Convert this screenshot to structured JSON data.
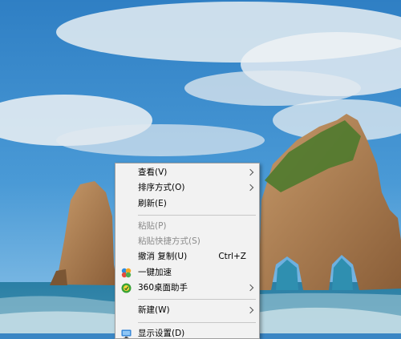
{
  "context_menu": {
    "view": {
      "label": "查看(V)"
    },
    "sort": {
      "label": "排序方式(O)"
    },
    "refresh": {
      "label": "刷新(E)"
    },
    "paste": {
      "label": "粘贴(P)"
    },
    "paste_shortcut": {
      "label": "粘贴快捷方式(S)"
    },
    "undo_copy": {
      "label": "撤消 复制(U)",
      "shortcut": "Ctrl+Z"
    },
    "speedup": {
      "label": "一键加速",
      "icon": "speedup-icon"
    },
    "desktop_helper": {
      "label": "360桌面助手",
      "icon": "360-helper-icon"
    },
    "new": {
      "label": "新建(W)"
    },
    "display_settings": {
      "label": "显示设置(D)",
      "icon": "display-settings-icon"
    }
  },
  "colors": {
    "menu_bg": "#f2f2f2",
    "menu_border": "#a0a0a0",
    "disabled_text": "#8a8a8a",
    "separator": "#c8c8c8"
  }
}
